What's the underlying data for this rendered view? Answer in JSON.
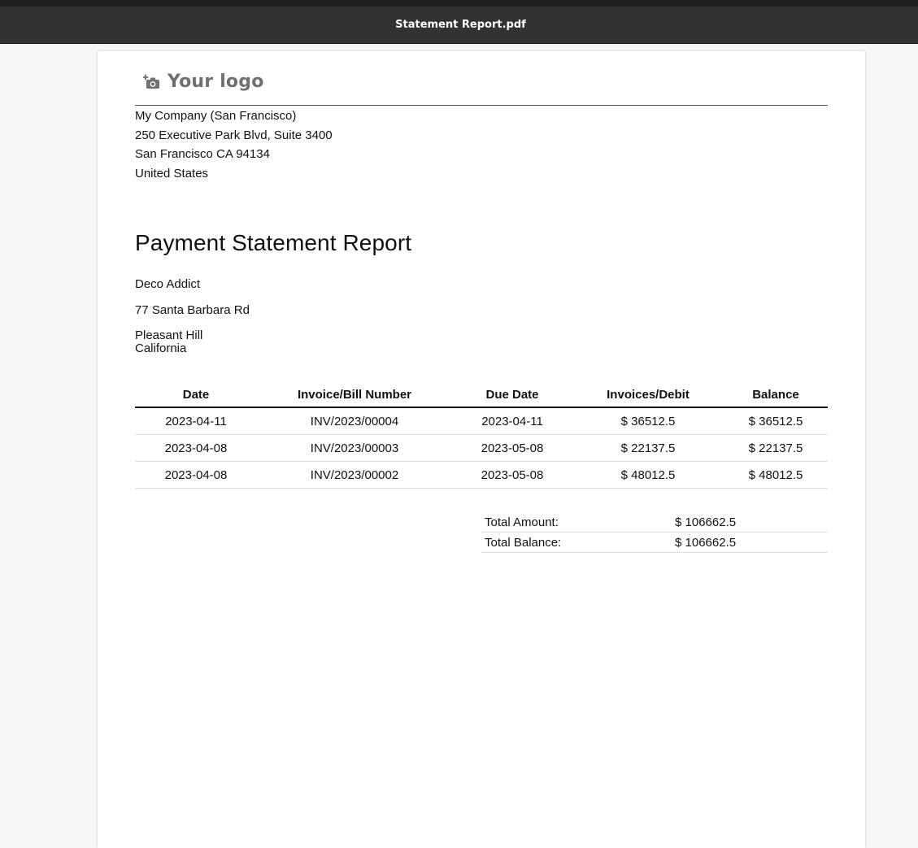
{
  "window": {
    "title": "Statement Report.pdf"
  },
  "logo": {
    "icon": "camera-plus-icon",
    "text": "Your logo"
  },
  "company": {
    "name": "My Company (San Francisco)",
    "street": "250 Executive Park Blvd, Suite 3400",
    "city_line": "San Francisco CA 94134",
    "country": "United States"
  },
  "report": {
    "title": "Payment Statement Report"
  },
  "partner": {
    "name": "Deco Addict",
    "street": "77 Santa Barbara Rd",
    "city": "Pleasant Hill",
    "state": "California"
  },
  "table": {
    "headers": [
      "Date",
      "Invoice/Bill Number",
      "Due Date",
      "Invoices/Debit",
      "Balance"
    ],
    "rows": [
      [
        "2023-04-11",
        "INV/2023/00004",
        "2023-04-11",
        "$ 36512.5",
        "$ 36512.5"
      ],
      [
        "2023-04-08",
        "INV/2023/00003",
        "2023-05-08",
        "$ 22137.5",
        "$ 22137.5"
      ],
      [
        "2023-04-08",
        "INV/2023/00002",
        "2023-05-08",
        "$ 48012.5",
        "$ 48012.5"
      ]
    ]
  },
  "totals": {
    "amount_label": "Total Amount:",
    "amount_value": "$ 106662.5",
    "balance_label": "Total Balance:",
    "balance_value": "$ 106662.5"
  },
  "colors": {
    "titlebar": "#323232",
    "page_background": "#ffffff",
    "viewer_background": "#f6f6f6",
    "logo_gray": "#707070"
  }
}
